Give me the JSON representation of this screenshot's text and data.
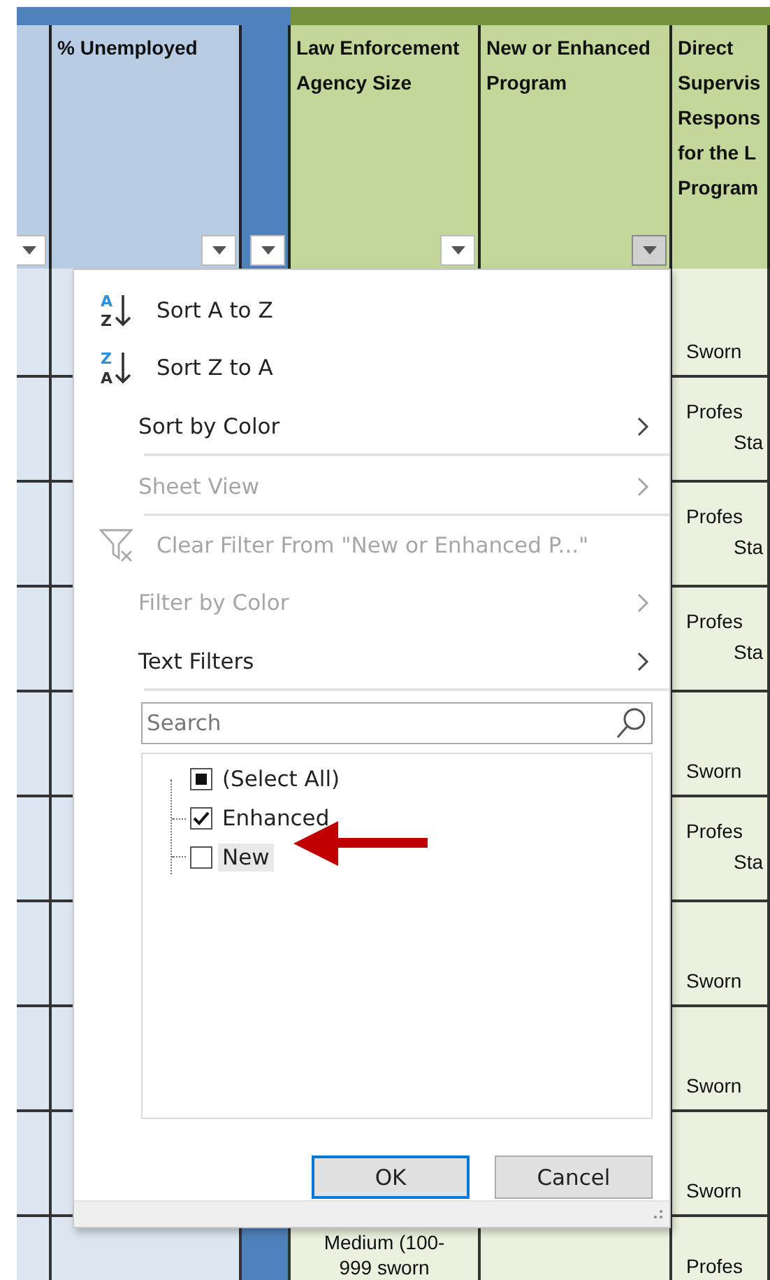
{
  "sheet": {
    "bands": [
      {
        "color": "#4f81bd",
        "columns": [
          {
            "color": "#b8cce4",
            "filter_button": true,
            "filter_open": false
          },
          {
            "label": "% Unemployed",
            "color": "#b8cce4",
            "filter_button": true,
            "filter_open": false
          },
          {
            "color": "#4f81bd",
            "filter_button": true,
            "filter_open": false
          }
        ]
      },
      {
        "color": "#76923c",
        "columns": [
          {
            "label": "Law Enforcement Agency Size",
            "color": "#c4d79b",
            "filter_button": true,
            "filter_open": false
          },
          {
            "label": "New or Enhanced Program",
            "color": "#c4d79b",
            "filter_button": true,
            "filter_open": true
          },
          {
            "lines": [
              "Direct",
              "Supervis",
              "Respons",
              "for the L",
              "Program"
            ],
            "color": "#c4d79b",
            "filter_button": false
          }
        ]
      }
    ],
    "rows": [
      {
        "column_6": [
          "Sworn"
        ]
      },
      {
        "column_6": [
          "Profes",
          "Sta"
        ]
      },
      {
        "column_6": [
          "Profes",
          "Sta"
        ]
      },
      {
        "column_6": [
          "Profes",
          "Sta"
        ]
      },
      {
        "column_6": [
          "Sworn"
        ]
      },
      {
        "column_6": [
          "Profes",
          "Sta"
        ]
      },
      {
        "column_6": [
          "Sworn"
        ]
      },
      {
        "column_6": [
          "Sworn"
        ]
      },
      {
        "column_6": [
          "Sworn"
        ]
      },
      {
        "agency_size": [
          "Medium (100-",
          "999 sworn"
        ],
        "column_6": [
          "Profes"
        ]
      }
    ]
  },
  "filter_menu": {
    "items": [
      {
        "kind": "sort",
        "label": "Sort A to Z",
        "icon_letters": [
          "A",
          "Z"
        ],
        "disabled": false,
        "divider_after": false
      },
      {
        "kind": "sort",
        "label": "Sort Z to A",
        "icon_letters": [
          "Z",
          "A"
        ],
        "disabled": false,
        "divider_after": false
      },
      {
        "kind": "submenu",
        "label": "Sort by Color",
        "disabled": false,
        "divider_after": true
      },
      {
        "kind": "submenu",
        "label": "Sheet View",
        "disabled": true,
        "divider_after": true
      },
      {
        "kind": "clear",
        "label": "Clear Filter From \"New or Enhanced P...\"",
        "disabled": true,
        "divider_after": false
      },
      {
        "kind": "submenu",
        "label": "Filter by Color",
        "disabled": true,
        "divider_after": false
      },
      {
        "kind": "submenu",
        "label": "Text Filters",
        "disabled": false,
        "divider_after": true
      }
    ],
    "search": {
      "placeholder": "Search"
    },
    "values": [
      {
        "label": "(Select All)",
        "checked": false,
        "mixed": true,
        "focused": false
      },
      {
        "label": "Enhanced",
        "checked": true,
        "focused": false
      },
      {
        "label": "New",
        "checked": false,
        "focused": true
      }
    ],
    "buttons": [
      {
        "label": "OK",
        "default": true
      },
      {
        "label": "Cancel",
        "default": false
      }
    ]
  },
  "annotation": {
    "kind": "arrow"
  }
}
